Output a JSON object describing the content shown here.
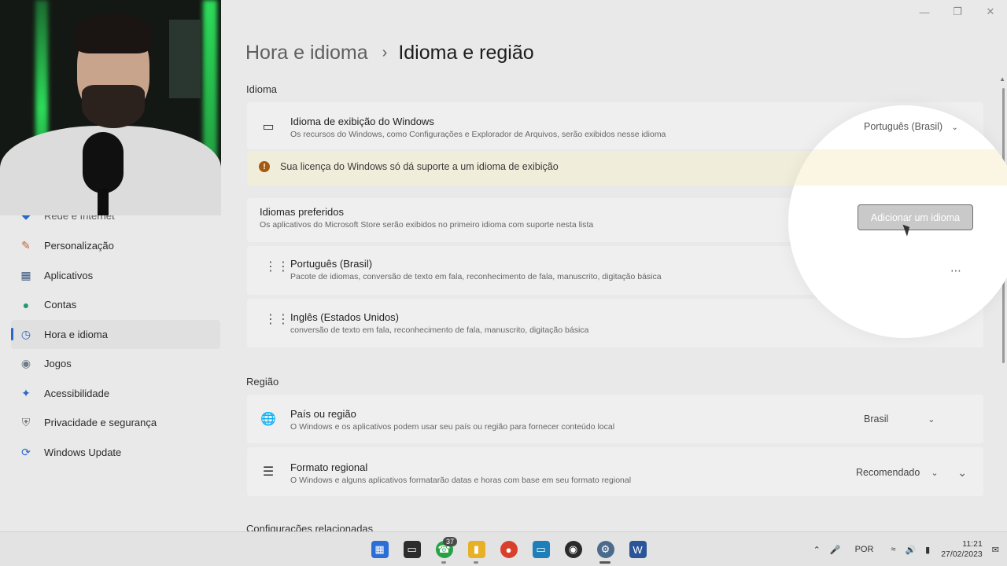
{
  "window": {
    "minimize_icon": "minimize-icon",
    "maximize_icon": "restore-icon",
    "close_icon": "close-icon"
  },
  "breadcrumb": {
    "parent": "Hora e idioma",
    "current": "Idioma e região"
  },
  "sidebar": {
    "items": [
      {
        "label": "Rede e Internet",
        "icon": "network-icon"
      },
      {
        "label": "Personalização",
        "icon": "brush-icon"
      },
      {
        "label": "Aplicativos",
        "icon": "apps-icon"
      },
      {
        "label": "Contas",
        "icon": "person-icon"
      },
      {
        "label": "Hora e idioma",
        "icon": "globe-clock-icon",
        "active": true
      },
      {
        "label": "Jogos",
        "icon": "gamepad-icon"
      },
      {
        "label": "Acessibilidade",
        "icon": "accessibility-icon"
      },
      {
        "label": "Privacidade e segurança",
        "icon": "shield-icon"
      },
      {
        "label": "Windows Update",
        "icon": "update-icon"
      }
    ]
  },
  "language_section": {
    "title": "Idioma",
    "display_language": {
      "title": "Idioma de exibição do Windows",
      "desc": "Os recursos do Windows, como Configurações e Explorador de Arquivos, serão exibidos nesse idioma",
      "value": "Português (Brasil)"
    },
    "license_warning": "Sua licença do Windows só dá suporte a um idioma de exibição",
    "preferred": {
      "title": "Idiomas preferidos",
      "desc": "Os aplicativos do Microsoft Store serão exibidos no primeiro idioma com suporte nesta lista",
      "add_button": "Adicionar um idioma"
    },
    "languages": [
      {
        "name": "Português (Brasil)",
        "desc": "Pacote de idiomas, conversão de texto em fala, reconhecimento de fala, manuscrito, digitação básica"
      },
      {
        "name": "Inglês (Estados Unidos)",
        "desc": "conversão de texto em fala, reconhecimento de fala, manuscrito, digitação básica"
      }
    ]
  },
  "region_section": {
    "title": "Região",
    "country": {
      "title": "País ou região",
      "desc": "O Windows e os aplicativos podem usar seu país ou região para fornecer conteúdo local",
      "value": "Brasil"
    },
    "format": {
      "title": "Formato regional",
      "desc": "O Windows e alguns aplicativos formatarão datas e horas com base em seu formato regional",
      "value": "Recomendado"
    }
  },
  "related_title": "Configurações relacionadas",
  "taskbar": {
    "apps": [
      {
        "name": "start",
        "color": "#2b6fd6"
      },
      {
        "name": "terminal",
        "color": "#2d2d2d"
      },
      {
        "name": "whatsapp",
        "color": "#25a244",
        "badge": "37"
      },
      {
        "name": "explorer",
        "color": "#e8b024"
      },
      {
        "name": "chrome",
        "color": "#d9402c"
      },
      {
        "name": "remote-desktop",
        "color": "#1f7fb8"
      },
      {
        "name": "recorder",
        "color": "#2a2a2a"
      },
      {
        "name": "settings",
        "color": "#4c6a8c"
      },
      {
        "name": "word",
        "color": "#2a5699"
      }
    ],
    "language": "POR",
    "time": "11:21",
    "date": "27/02/2023"
  }
}
